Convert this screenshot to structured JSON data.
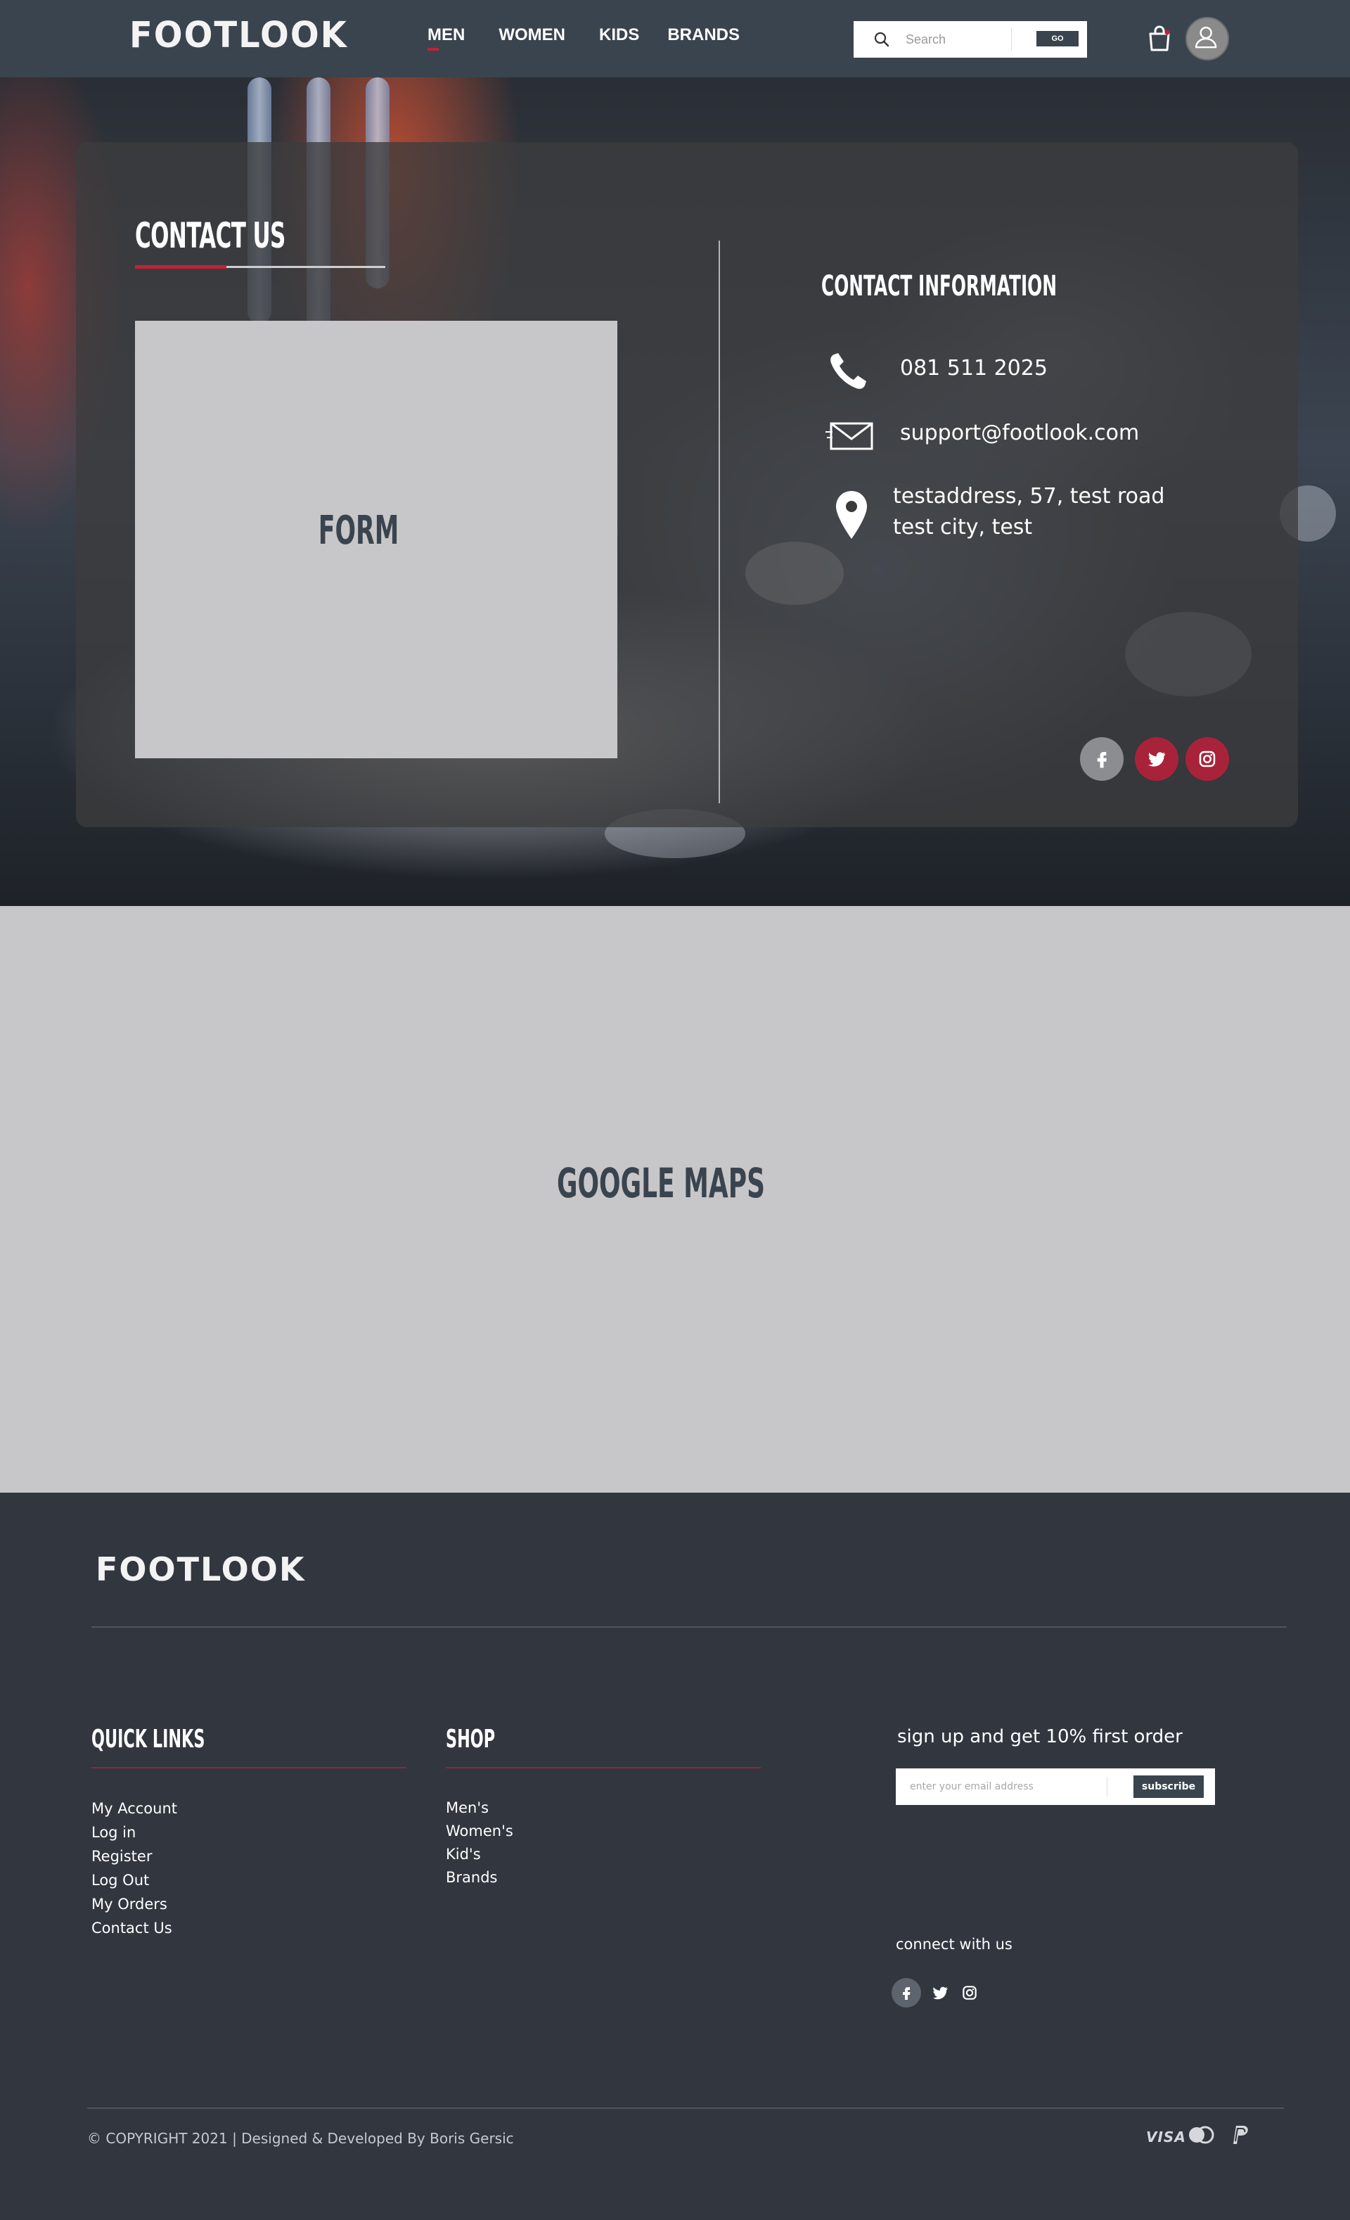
{
  "header": {
    "logo": "FOOTLOOK",
    "nav": [
      "MEN",
      "WOMEN",
      "KIDS",
      "BRANDS"
    ],
    "search": {
      "placeholder": "Search",
      "button": "GO"
    }
  },
  "contact": {
    "title": "CONTACT US",
    "form_placeholder": "FORM",
    "info_title": "CONTACT INFORMATION",
    "phone": "081 511 2025",
    "email": "support@footlook.com",
    "address_line1": "testaddress, 57, test road",
    "address_line2": "test city, test",
    "social_icons": [
      "facebook-icon",
      "twitter-icon",
      "instagram-icon"
    ]
  },
  "map": {
    "label": "GOOGLE MAPS"
  },
  "footer": {
    "logo": "FOOTLOOK",
    "quick_links": {
      "title": "QUICK LINKS",
      "items": [
        "My Account",
        "Log in",
        "Register",
        "Log Out",
        "My Orders",
        "Contact Us"
      ]
    },
    "shop": {
      "title": "SHOP",
      "items": [
        "Men's",
        "Women's",
        "Kid's",
        "Brands"
      ]
    },
    "signup": {
      "title": "sign up and get 10% first order",
      "placeholder": "enter your email address",
      "button": "subscribe"
    },
    "connect_label": "connect with us",
    "copyright": "© COPYRIGHT 2021 | Designed & Developed By Boris Gersic",
    "payment": {
      "visa": "VISA",
      "icons": [
        "mastercard-icon",
        "paypal-icon"
      ]
    }
  },
  "colors": {
    "header_bg": "#3a444e",
    "footer_bg": "#31363f",
    "accent": "#c0223a",
    "placeholder_bg": "#c7c7c9"
  }
}
